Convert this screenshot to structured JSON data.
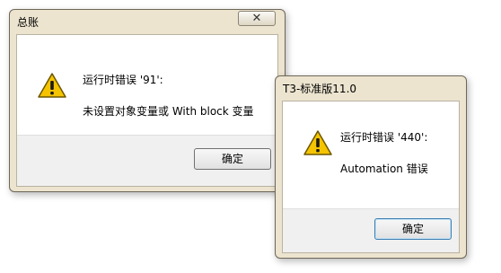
{
  "dialog_ledger": {
    "title": "总账",
    "close_symbol": "✕",
    "message_line1": "运行时错误 '91':",
    "message_line2": "未设置对象变量或 With block 变量",
    "ok_label": "确定",
    "icon": "warning-triangle-icon"
  },
  "dialog_t3": {
    "title": "T3-标准版11.0",
    "message_line1": "运行时错误 '440':",
    "message_line2": "Automation 错误",
    "ok_label": "确定",
    "icon": "warning-triangle-icon"
  },
  "colors": {
    "window_frame": "#ece4cf",
    "warning_yellow": "#f5c400",
    "focus_border": "#3c7fb1"
  }
}
